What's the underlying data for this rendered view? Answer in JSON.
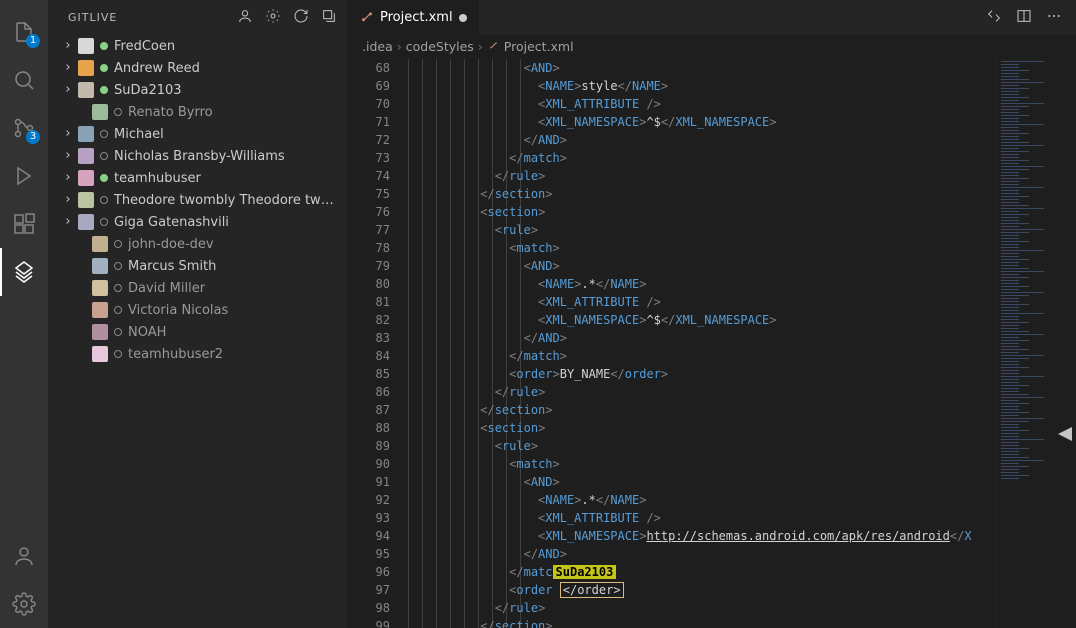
{
  "activity": {
    "explorer_badge": "1",
    "scm_badge": "3"
  },
  "sidebar": {
    "title": "GITLIVE",
    "users": [
      {
        "chevron": true,
        "indent": 1,
        "avatar_bg": "#d8d8d8",
        "status": "online",
        "name": "FredCoen",
        "dim": false
      },
      {
        "chevron": true,
        "indent": 1,
        "avatar_bg": "#e8a34a",
        "status": "online",
        "name": "Andrew Reed",
        "dim": false
      },
      {
        "chevron": true,
        "indent": 1,
        "avatar_bg": "#c3b9ad",
        "status": "online",
        "name": "SuDa2103",
        "dim": false
      },
      {
        "chevron": false,
        "indent": 2,
        "avatar_bg": "#9dbb9b",
        "status": "offline",
        "name": "Renato Byrro",
        "dim": true
      },
      {
        "chevron": true,
        "indent": 1,
        "avatar_bg": "#8aa2b6",
        "status": "offline",
        "name": "Michael",
        "dim": false
      },
      {
        "chevron": true,
        "indent": 1,
        "avatar_bg": "#b7a1c5",
        "status": "offline",
        "name": "Nicholas Bransby-Williams",
        "dim": false
      },
      {
        "chevron": true,
        "indent": 1,
        "avatar_bg": "#d6a3be",
        "status": "online",
        "name": "teamhubuser",
        "dim": false
      },
      {
        "chevron": true,
        "indent": 1,
        "avatar_bg": "#b9c4a0",
        "status": "offline",
        "name": "Theodore twombly Theodore two…",
        "dim": false
      },
      {
        "chevron": true,
        "indent": 1,
        "avatar_bg": "#a8a8c0",
        "status": "offline",
        "name": "Giga Gatenashvili",
        "dim": false
      },
      {
        "chevron": false,
        "indent": 2,
        "avatar_bg": "#c0b090",
        "status": "offline",
        "name": "john-doe-dev",
        "dim": true
      },
      {
        "chevron": false,
        "indent": 2,
        "avatar_bg": "#a0b0c0",
        "status": "offline",
        "name": "Marcus Smith",
        "dim": false
      },
      {
        "chevron": false,
        "indent": 2,
        "avatar_bg": "#d0c0a0",
        "status": "offline",
        "name": "David Miller",
        "dim": true
      },
      {
        "chevron": false,
        "indent": 2,
        "avatar_bg": "#caa090",
        "status": "offline",
        "name": "Victoria Nicolas",
        "dim": true
      },
      {
        "chevron": false,
        "indent": 2,
        "avatar_bg": "#b090a0",
        "status": "offline",
        "name": "NOAH",
        "dim": true
      },
      {
        "chevron": false,
        "indent": 2,
        "avatar_bg": "#e8c8dc",
        "status": "offline",
        "name": "teamhubuser2",
        "dim": true
      }
    ]
  },
  "editor": {
    "tab_label": "Project.xml",
    "breadcrumbs": [
      ".idea",
      "codeStyles",
      "Project.xml"
    ],
    "first_line": 68,
    "presence_label": "SuDa2103",
    "code": [
      [
        [
          16,
          "b",
          "<"
        ],
        [
          0,
          "t",
          "AND"
        ],
        [
          0,
          "b",
          ">"
        ]
      ],
      [
        [
          18,
          "b",
          "<"
        ],
        [
          0,
          "t",
          "NAME"
        ],
        [
          0,
          "b",
          ">"
        ],
        [
          0,
          "x",
          "style"
        ],
        [
          0,
          "b",
          "</"
        ],
        [
          0,
          "t",
          "NAME"
        ],
        [
          0,
          "b",
          ">"
        ]
      ],
      [
        [
          18,
          "b",
          "<"
        ],
        [
          0,
          "t",
          "XML_ATTRIBUTE"
        ],
        [
          0,
          "x",
          " "
        ],
        [
          0,
          "b",
          "/>"
        ]
      ],
      [
        [
          18,
          "b",
          "<"
        ],
        [
          0,
          "t",
          "XML_NAMESPACE"
        ],
        [
          0,
          "b",
          ">"
        ],
        [
          0,
          "x",
          "^$"
        ],
        [
          0,
          "b",
          "</"
        ],
        [
          0,
          "t",
          "XML_NAMESPACE"
        ],
        [
          0,
          "b",
          ">"
        ]
      ],
      [
        [
          16,
          "b",
          "</"
        ],
        [
          0,
          "t",
          "AND"
        ],
        [
          0,
          "b",
          ">"
        ]
      ],
      [
        [
          14,
          "b",
          "</"
        ],
        [
          0,
          "t",
          "match"
        ],
        [
          0,
          "b",
          ">"
        ]
      ],
      [
        [
          12,
          "b",
          "</"
        ],
        [
          0,
          "t",
          "rule"
        ],
        [
          0,
          "b",
          ">"
        ]
      ],
      [
        [
          10,
          "b",
          "</"
        ],
        [
          0,
          "t",
          "section"
        ],
        [
          0,
          "b",
          ">"
        ]
      ],
      [
        [
          10,
          "b",
          "<"
        ],
        [
          0,
          "t",
          "section"
        ],
        [
          0,
          "b",
          ">"
        ]
      ],
      [
        [
          12,
          "b",
          "<"
        ],
        [
          0,
          "t",
          "rule"
        ],
        [
          0,
          "b",
          ">"
        ]
      ],
      [
        [
          14,
          "b",
          "<"
        ],
        [
          0,
          "t",
          "match"
        ],
        [
          0,
          "b",
          ">"
        ]
      ],
      [
        [
          16,
          "b",
          "<"
        ],
        [
          0,
          "t",
          "AND"
        ],
        [
          0,
          "b",
          ">"
        ]
      ],
      [
        [
          18,
          "b",
          "<"
        ],
        [
          0,
          "t",
          "NAME"
        ],
        [
          0,
          "b",
          ">"
        ],
        [
          0,
          "x",
          ".*"
        ],
        [
          0,
          "b",
          "</"
        ],
        [
          0,
          "t",
          "NAME"
        ],
        [
          0,
          "b",
          ">"
        ]
      ],
      [
        [
          18,
          "b",
          "<"
        ],
        [
          0,
          "t",
          "XML_ATTRIBUTE"
        ],
        [
          0,
          "x",
          " "
        ],
        [
          0,
          "b",
          "/>"
        ]
      ],
      [
        [
          18,
          "b",
          "<"
        ],
        [
          0,
          "t",
          "XML_NAMESPACE"
        ],
        [
          0,
          "b",
          ">"
        ],
        [
          0,
          "x",
          "^$"
        ],
        [
          0,
          "b",
          "</"
        ],
        [
          0,
          "t",
          "XML_NAMESPACE"
        ],
        [
          0,
          "b",
          ">"
        ]
      ],
      [
        [
          16,
          "b",
          "</"
        ],
        [
          0,
          "t",
          "AND"
        ],
        [
          0,
          "b",
          ">"
        ]
      ],
      [
        [
          14,
          "b",
          "</"
        ],
        [
          0,
          "t",
          "match"
        ],
        [
          0,
          "b",
          ">"
        ]
      ],
      [
        [
          14,
          "b",
          "<"
        ],
        [
          0,
          "t",
          "order"
        ],
        [
          0,
          "b",
          ">"
        ],
        [
          0,
          "x",
          "BY_NAME"
        ],
        [
          0,
          "b",
          "</"
        ],
        [
          0,
          "t",
          "order"
        ],
        [
          0,
          "b",
          ">"
        ]
      ],
      [
        [
          12,
          "b",
          "</"
        ],
        [
          0,
          "t",
          "rule"
        ],
        [
          0,
          "b",
          ">"
        ]
      ],
      [
        [
          10,
          "b",
          "</"
        ],
        [
          0,
          "t",
          "section"
        ],
        [
          0,
          "b",
          ">"
        ]
      ],
      [
        [
          10,
          "b",
          "<"
        ],
        [
          0,
          "t",
          "section"
        ],
        [
          0,
          "b",
          ">"
        ]
      ],
      [
        [
          12,
          "b",
          "<"
        ],
        [
          0,
          "t",
          "rule"
        ],
        [
          0,
          "b",
          ">"
        ]
      ],
      [
        [
          14,
          "b",
          "<"
        ],
        [
          0,
          "t",
          "match"
        ],
        [
          0,
          "b",
          ">"
        ]
      ],
      [
        [
          16,
          "b",
          "<"
        ],
        [
          0,
          "t",
          "AND"
        ],
        [
          0,
          "b",
          ">"
        ]
      ],
      [
        [
          18,
          "b",
          "<"
        ],
        [
          0,
          "t",
          "NAME"
        ],
        [
          0,
          "b",
          ">"
        ],
        [
          0,
          "x",
          ".*"
        ],
        [
          0,
          "b",
          "</"
        ],
        [
          0,
          "t",
          "NAME"
        ],
        [
          0,
          "b",
          ">"
        ]
      ],
      [
        [
          18,
          "b",
          "<"
        ],
        [
          0,
          "t",
          "XML_ATTRIBUTE"
        ],
        [
          0,
          "x",
          " "
        ],
        [
          0,
          "b",
          "/>"
        ]
      ],
      [
        [
          18,
          "b",
          "<"
        ],
        [
          0,
          "t",
          "XML_NAMESPACE"
        ],
        [
          0,
          "b",
          ">"
        ],
        [
          0,
          "u",
          "http://schemas.android.com/apk/res/android"
        ],
        [
          0,
          "b",
          "</"
        ],
        [
          0,
          "t",
          "X"
        ]
      ],
      [
        [
          16,
          "b",
          "</"
        ],
        [
          0,
          "t",
          "AND"
        ],
        [
          0,
          "b",
          ">"
        ]
      ],
      [
        [
          14,
          "b",
          "</"
        ],
        [
          0,
          "t",
          "matc"
        ],
        [
          0,
          "p",
          ""
        ]
      ],
      [
        [
          14,
          "b",
          "<"
        ],
        [
          0,
          "t",
          "order"
        ],
        [
          0,
          "x",
          " "
        ],
        [
          0,
          "box",
          "</order>"
        ]
      ],
      [
        [
          12,
          "b",
          "</"
        ],
        [
          0,
          "t",
          "rule"
        ],
        [
          0,
          "b",
          ">"
        ]
      ],
      [
        [
          10,
          "b",
          "</"
        ],
        [
          0,
          "t",
          "section"
        ],
        [
          0,
          "b",
          ">"
        ]
      ]
    ]
  }
}
